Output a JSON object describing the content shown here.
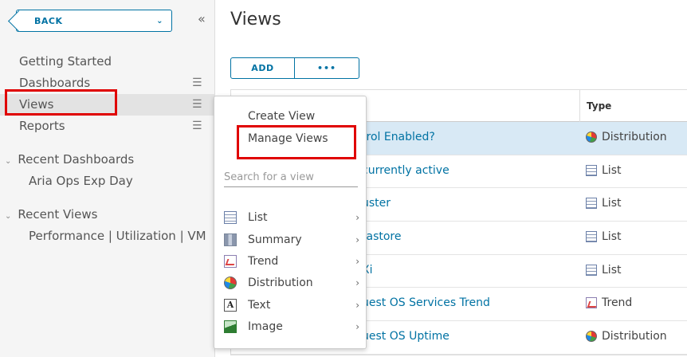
{
  "sidebar": {
    "back_label": "BACK",
    "back_chevron": "⌄",
    "collapse_icon": "«",
    "nav": [
      {
        "label": "Getting Started"
      },
      {
        "label": "Dashboards"
      },
      {
        "label": "Views"
      },
      {
        "label": "Reports"
      }
    ],
    "menu_icon": "☰",
    "recent_dashboards": {
      "title": "Recent Dashboards",
      "items": [
        "Aria Ops Exp Day"
      ]
    },
    "recent_views": {
      "title": "Recent Views",
      "items": [
        "Performance | Utilization | VM"
      ]
    },
    "section_chevron": "⌄"
  },
  "main": {
    "title": "Views",
    "add_label": "ADD",
    "more_label": "•••",
    "table": {
      "type_header": "Type",
      "rows": [
        {
          "name": "trol Enabled?",
          "type": "Distribution",
          "icon": "distribution-icon",
          "selected": true
        },
        {
          "name": "currently active",
          "type": "List",
          "icon": "list-icon"
        },
        {
          "name": "uster",
          "type": "List",
          "icon": "list-icon"
        },
        {
          "name": "tastore",
          "type": "List",
          "icon": "list-icon"
        },
        {
          "name": "Xi",
          "type": "List",
          "icon": "list-icon"
        },
        {
          "name": "uest OS Services Trend",
          "type": "Trend",
          "icon": "trend-icon"
        },
        {
          "name": "uest OS Uptime",
          "type": "Distribution",
          "icon": "distribution-icon"
        }
      ]
    }
  },
  "popup": {
    "create_view": "Create View",
    "manage_views": "Manage Views",
    "search_placeholder": "Search for a view",
    "categories": [
      {
        "label": "List",
        "icon": "list-icon"
      },
      {
        "label": "Summary",
        "icon": "summary-icon"
      },
      {
        "label": "Trend",
        "icon": "trend-icon"
      },
      {
        "label": "Distribution",
        "icon": "distribution-icon"
      },
      {
        "label": "Text",
        "icon": "text-icon"
      },
      {
        "label": "Image",
        "icon": "image-icon"
      }
    ],
    "arrow": "›",
    "text_icon_glyph": "A"
  },
  "colors": {
    "accent": "#0072a3",
    "highlight": "#e00000",
    "selected_row": "#d8e9f5"
  }
}
